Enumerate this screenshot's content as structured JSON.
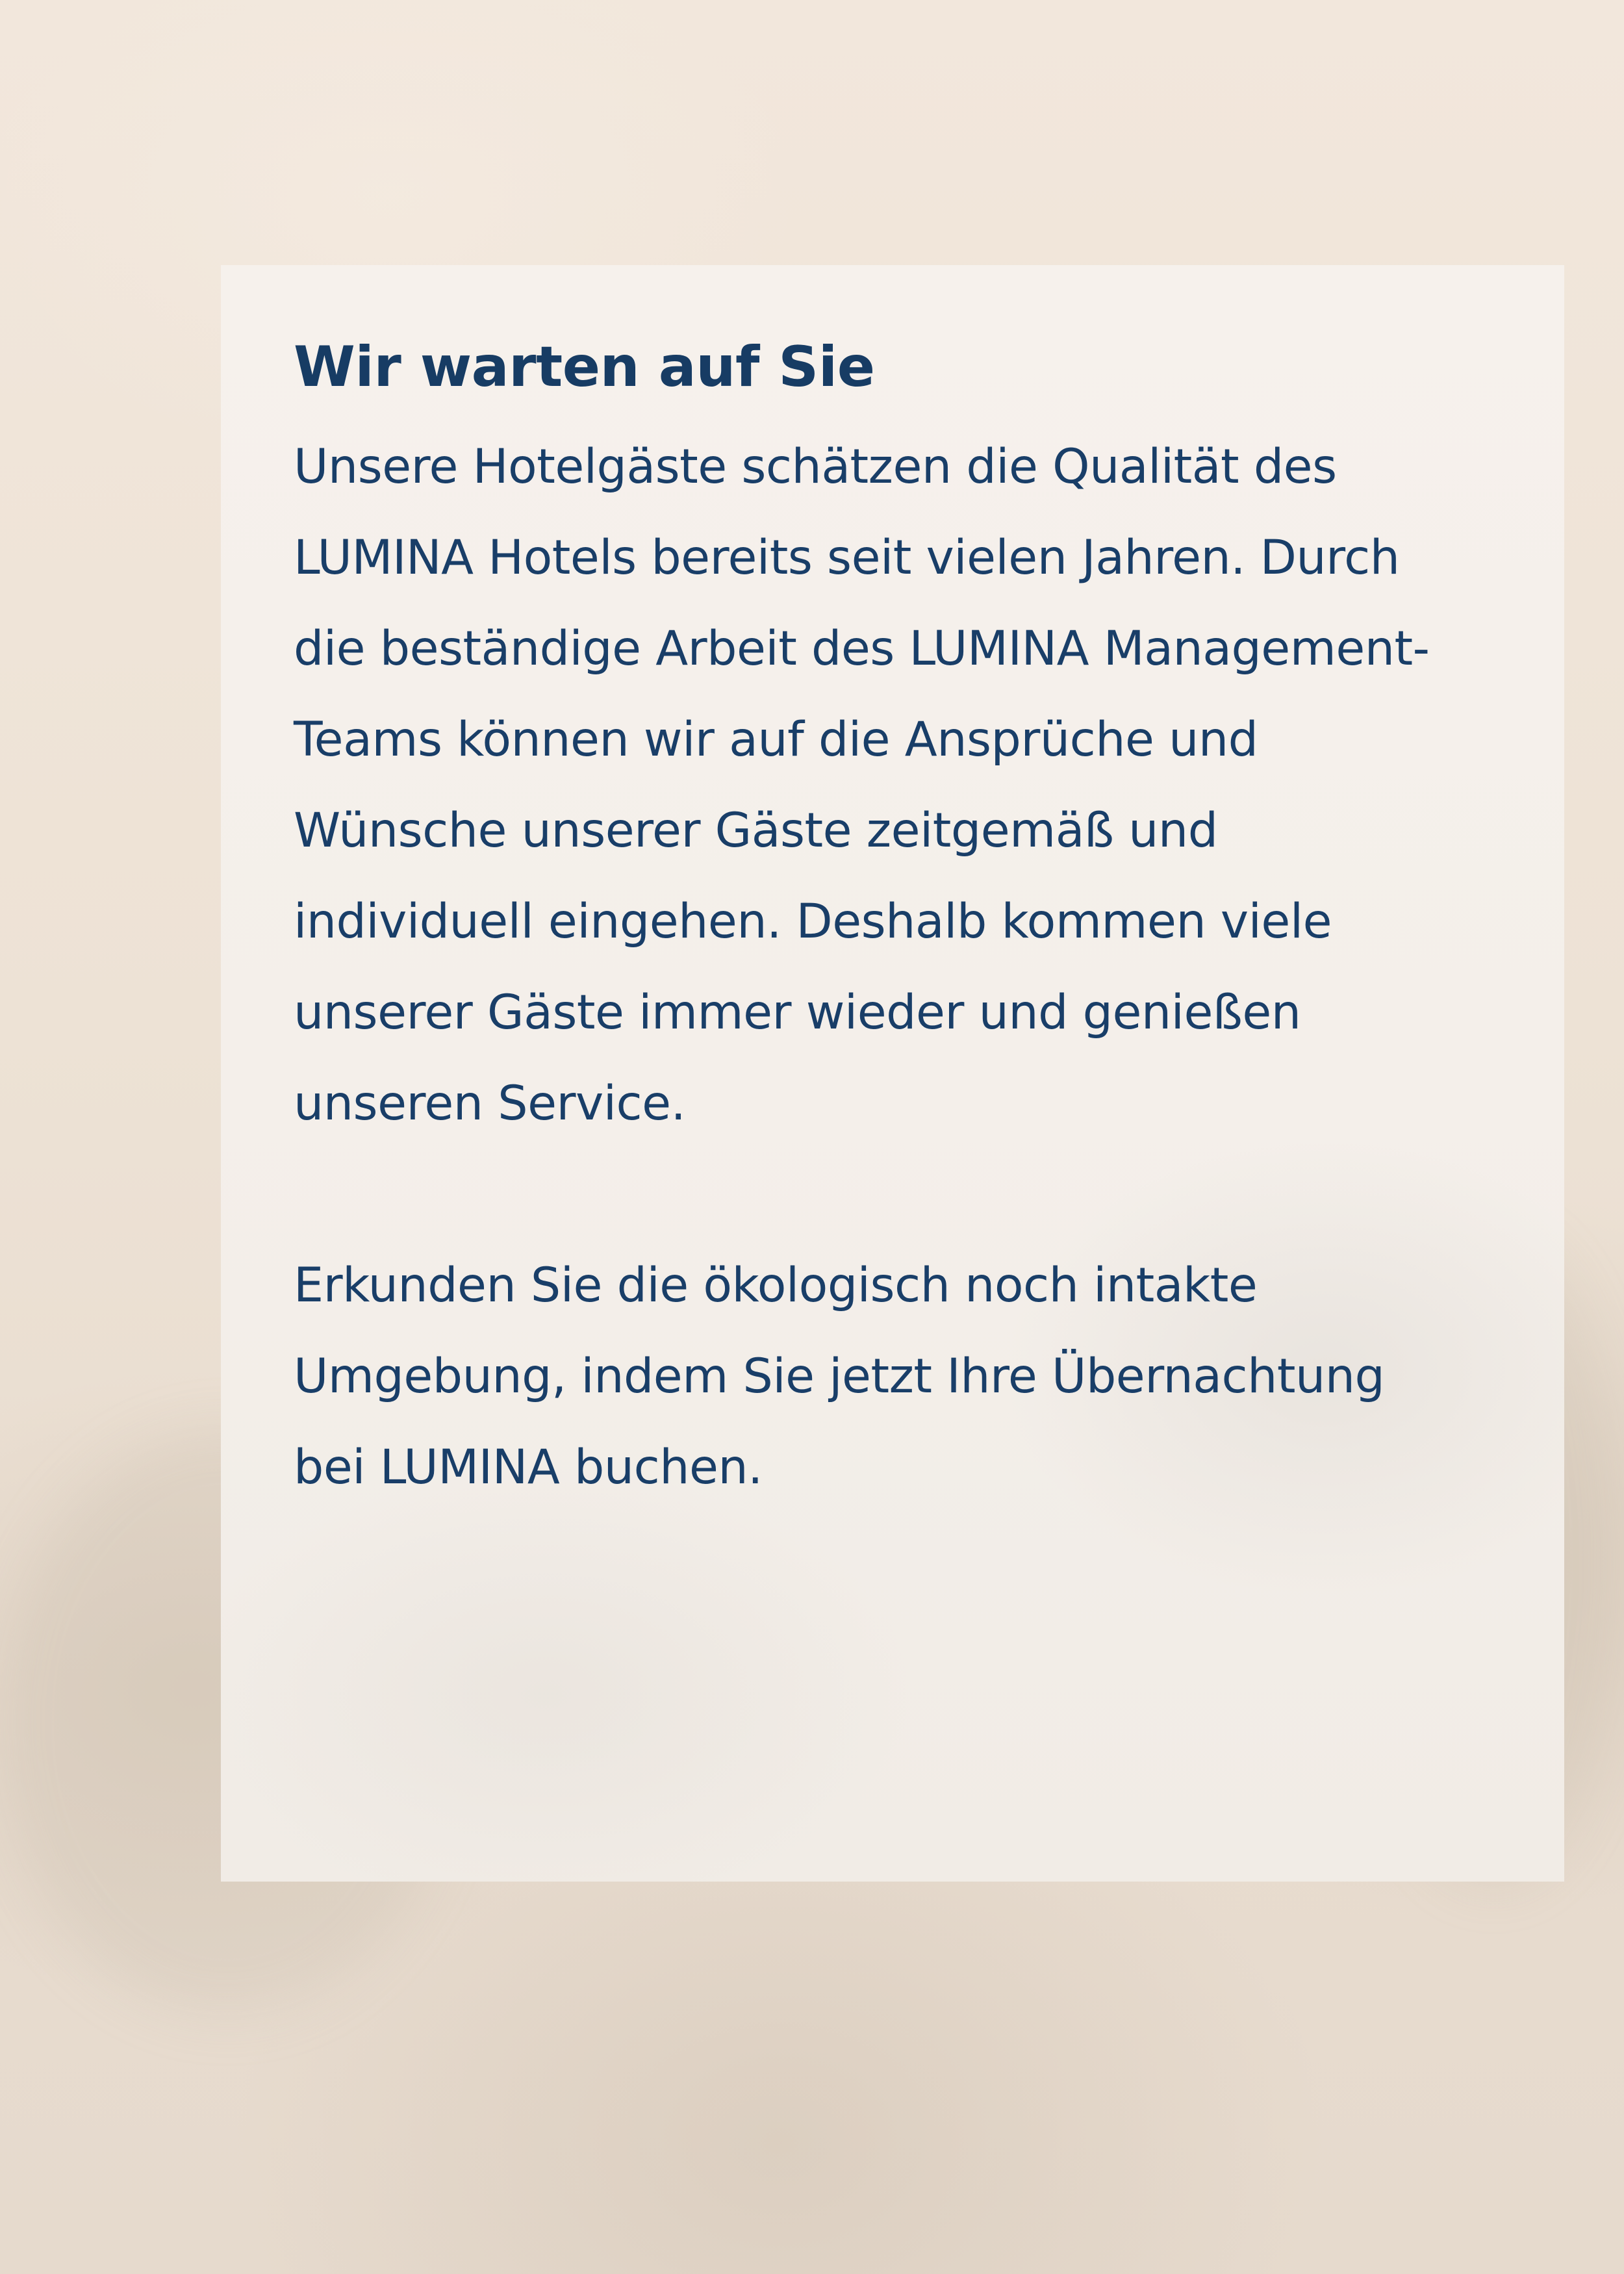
{
  "card": {
    "heading": "Wir warten auf Sie",
    "paragraph1_lines": [
      "Unsere Hotelgäste schätzen die Qualität des",
      "LUMINA Hotels bereits seit vielen Jahren. Durch",
      "die beständige Arbeit des LUMINA Management-",
      "Teams können wir auf die Ansprüche und",
      "Wünsche unserer Gäste zeitgemäß und",
      "individuell eingehen. Deshalb kommen viele",
      "unserer Gäste immer wieder und genießen",
      "unseren Service."
    ],
    "paragraph2_lines": [
      "Erkunden Sie die ökologisch noch intakte",
      "Umgebung, indem Sie jetzt Ihre Übernachtung",
      "bei LUMINA buchen."
    ]
  },
  "colors": {
    "text": "#193e68",
    "heading": "#173c64",
    "card": "#f4efea",
    "background": "#ede2d5"
  }
}
